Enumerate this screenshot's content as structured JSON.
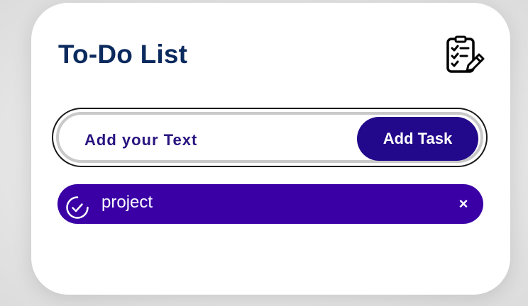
{
  "app": {
    "title": "To-Do List",
    "title_icon": "checklist-edit-icon"
  },
  "input": {
    "placeholder": "Add your Text",
    "value": ""
  },
  "add_button": {
    "label": "Add Task"
  },
  "tasks": [
    {
      "text": "project",
      "status_icon": "check-circle-icon",
      "delete_label": "×"
    }
  ],
  "colors": {
    "title": "#0b2a5e",
    "input_text": "#2a1480",
    "button_bg": "#22088a",
    "task_bg": "#3a00a6",
    "card_bg": "#ffffff"
  }
}
